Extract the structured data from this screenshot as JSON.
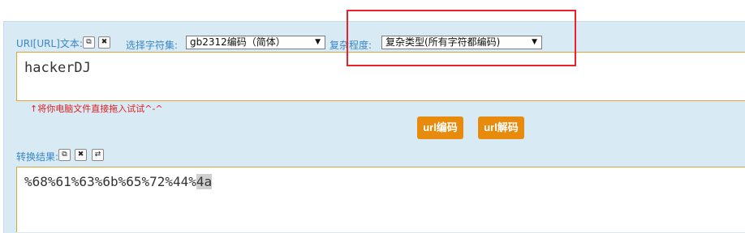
{
  "input_section": {
    "label": "URI[URL]文本:",
    "copy_icon": "copy-icon",
    "clear_icon": "close-icon"
  },
  "charset": {
    "label": "选择字符集:",
    "selected": "gb2312编码（简体）"
  },
  "complexity": {
    "label": "复杂程度:",
    "selected": "复杂类型(所有字符都编码)"
  },
  "input": {
    "value": "hackerDJ"
  },
  "hint": "↑将你电脑文件直接拖入试试^-^",
  "buttons": {
    "encode": "url编码",
    "decode": "url解码"
  },
  "result_section": {
    "label": "转换结果:",
    "copy_icon": "copy-icon",
    "clear_icon": "close-icon",
    "swap_icon": "swap-icon"
  },
  "result": {
    "value_main": "%68%61%63%6b%65%72%44%",
    "value_selected": "4a"
  },
  "colors": {
    "accent": "#e88b0c",
    "panel": "#d8eaf4",
    "label": "#3a86c6",
    "highlight_box": "#e8232b"
  }
}
